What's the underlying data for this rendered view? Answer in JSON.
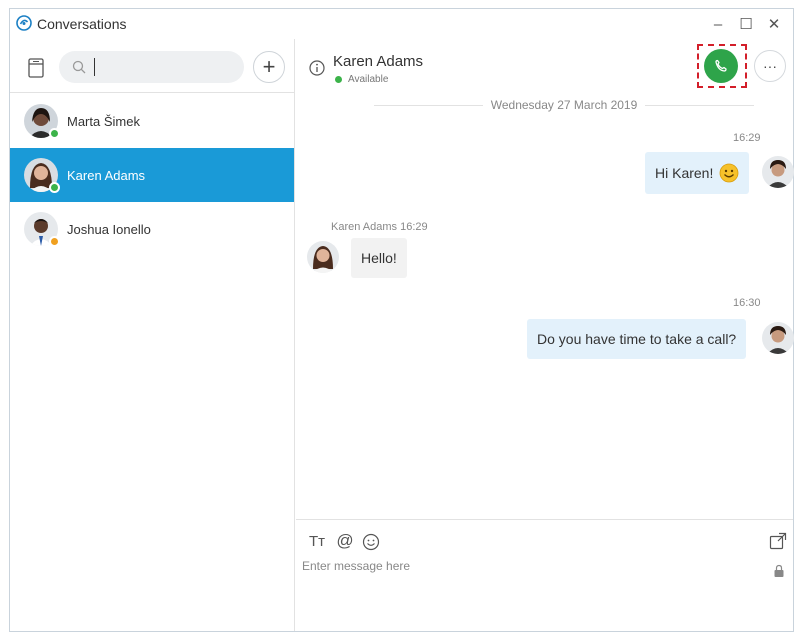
{
  "window": {
    "title": "Conversations",
    "minimize_label": "–",
    "maximize_label": "☐",
    "close_label": "✕"
  },
  "sidebar": {
    "search": {
      "placeholder": "",
      "value": ""
    },
    "add_label": "+",
    "conversations": [
      {
        "name": "Marta Šimek",
        "presence": "available",
        "active": false
      },
      {
        "name": "Karen Adams",
        "presence": "available",
        "active": true
      },
      {
        "name": "Joshua Ionello",
        "presence": "away",
        "active": false
      }
    ]
  },
  "chat": {
    "contact_name": "Karen Adams",
    "status_text": "Available",
    "more_label": "···",
    "date_divider": "Wednesday 27 March 2019",
    "messages": [
      {
        "direction": "out",
        "time": "16:29",
        "text": "Hi Karen!",
        "emoji": "smiley-face"
      },
      {
        "direction": "in",
        "sender": "Karen Adams",
        "time": "16:29",
        "text": "Hello!"
      },
      {
        "direction": "out",
        "time": "16:30",
        "text": "Do you have time to take a call?"
      }
    ],
    "compose": {
      "placeholder": "Enter message here",
      "format_label": "Tт",
      "mention_label": "@"
    }
  },
  "colors": {
    "accent": "#1a9ad7",
    "available": "#3cb34a",
    "away": "#f0a020",
    "call_button": "#2ea44a",
    "highlight_border": "#d31f2a",
    "outgoing_bubble": "#e3f1fb",
    "incoming_bubble": "#f2f2f2"
  }
}
